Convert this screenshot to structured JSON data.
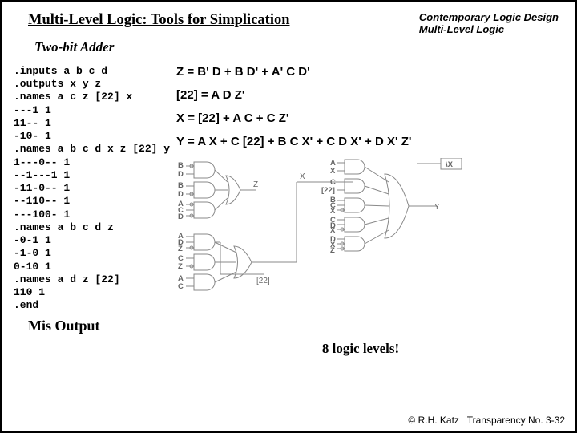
{
  "header": {
    "title": "Multi-Level Logic: Tools for Simplication",
    "brand_line1": "Contemporary Logic Design",
    "brand_line2": "Multi-Level Logic",
    "subtitle": "Two-bit Adder"
  },
  "netlist": ".inputs a b c d\n.outputs x y z\n.names a c z [22] x\n---1 1\n11-- 1\n-10- 1\n.names a b c d x z [22] y\n1---0-- 1\n--1---1 1\n-11-0-- 1\n--110-- 1\n---100- 1\n.names a b c d z\n-0-1 1\n-1-0 1\n0-10 1\n.names a d z [22]\n110 1\n.end",
  "equations": {
    "z": "Z = B' D + B D' + A' C D'",
    "t22": "[22] = A D Z'",
    "x": "X = [22] + A C + C Z'",
    "y": "Y = A X + C [22] + B C X' + C D X' + D X' Z'"
  },
  "mis_label": "Mis Output",
  "levels_label": "8 logic levels!",
  "footer": {
    "copyright": "© R.H. Katz",
    "transparency": "Transparency No. 3-32"
  },
  "gate_labels": {
    "B1": "B",
    "D1": "D",
    "B2": "B",
    "D2": "D",
    "A1": "A",
    "C1": "C",
    "D3": "D",
    "Z": "Z",
    "A2": "A",
    "D4": "D",
    "Z2": "Z",
    "C2": "C",
    "Z3": "Z",
    "A3": "A",
    "C3": "C",
    "T22": "[22]",
    "X": "X",
    "A4": "A",
    "X2": "X",
    "C4": "C",
    "T22b": "[22]",
    "B3": "B",
    "C5": "C",
    "X3": "X",
    "C6": "C",
    "D5": "D",
    "X4": "X",
    "D6": "D",
    "X5": "X",
    "Z4": "Z",
    "Y": "Y",
    "Xout": "\\X"
  }
}
